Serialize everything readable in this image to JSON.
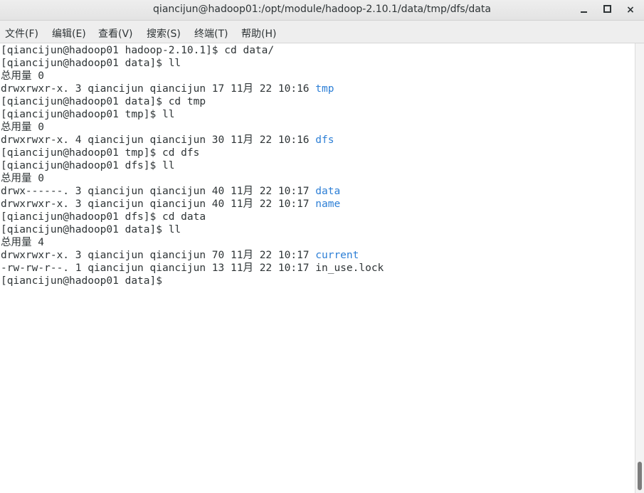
{
  "window": {
    "title": "qiancijun@hadoop01:/opt/module/hadoop-2.10.1/data/tmp/dfs/data",
    "minimize_glyph": "",
    "maximize_glyph": "",
    "close_glyph": "×"
  },
  "menu": {
    "items": [
      {
        "label": "文件(F)"
      },
      {
        "label": "编辑(E)"
      },
      {
        "label": "查看(V)"
      },
      {
        "label": "搜索(S)"
      },
      {
        "label": "终端(T)"
      },
      {
        "label": "帮助(H)"
      }
    ]
  },
  "terminal": {
    "lines": [
      {
        "text": "[qiancijun@hadoop01 hadoop-2.10.1]$ cd data/",
        "dir": ""
      },
      {
        "text": "[qiancijun@hadoop01 data]$ ll",
        "dir": ""
      },
      {
        "text": "总用量 0",
        "dir": ""
      },
      {
        "text": "drwxrwxr-x. 3 qiancijun qiancijun 17 11月 22 10:16 ",
        "dir": "tmp"
      },
      {
        "text": "[qiancijun@hadoop01 data]$ cd tmp",
        "dir": ""
      },
      {
        "text": "[qiancijun@hadoop01 tmp]$ ll",
        "dir": ""
      },
      {
        "text": "总用量 0",
        "dir": ""
      },
      {
        "text": "drwxrwxr-x. 4 qiancijun qiancijun 30 11月 22 10:16 ",
        "dir": "dfs"
      },
      {
        "text": "[qiancijun@hadoop01 tmp]$ cd dfs",
        "dir": ""
      },
      {
        "text": "[qiancijun@hadoop01 dfs]$ ll",
        "dir": ""
      },
      {
        "text": "总用量 0",
        "dir": ""
      },
      {
        "text": "drwx------. 3 qiancijun qiancijun 40 11月 22 10:17 ",
        "dir": "data"
      },
      {
        "text": "drwxrwxr-x. 3 qiancijun qiancijun 40 11月 22 10:17 ",
        "dir": "name"
      },
      {
        "text": "[qiancijun@hadoop01 dfs]$ cd data",
        "dir": ""
      },
      {
        "text": "[qiancijun@hadoop01 data]$ ll",
        "dir": ""
      },
      {
        "text": "总用量 4",
        "dir": ""
      },
      {
        "text": "drwxrwxr-x. 3 qiancijun qiancijun 70 11月 22 10:17 ",
        "dir": "current"
      },
      {
        "text": "-rw-rw-r--. 1 qiancijun qiancijun 13 11月 22 10:17 in_use.lock",
        "dir": ""
      },
      {
        "text": "[qiancijun@hadoop01 data]$ ",
        "dir": ""
      }
    ]
  },
  "colors": {
    "directory": "#2d7fd6",
    "text": "#2e3436",
    "background": "#ffffff"
  }
}
